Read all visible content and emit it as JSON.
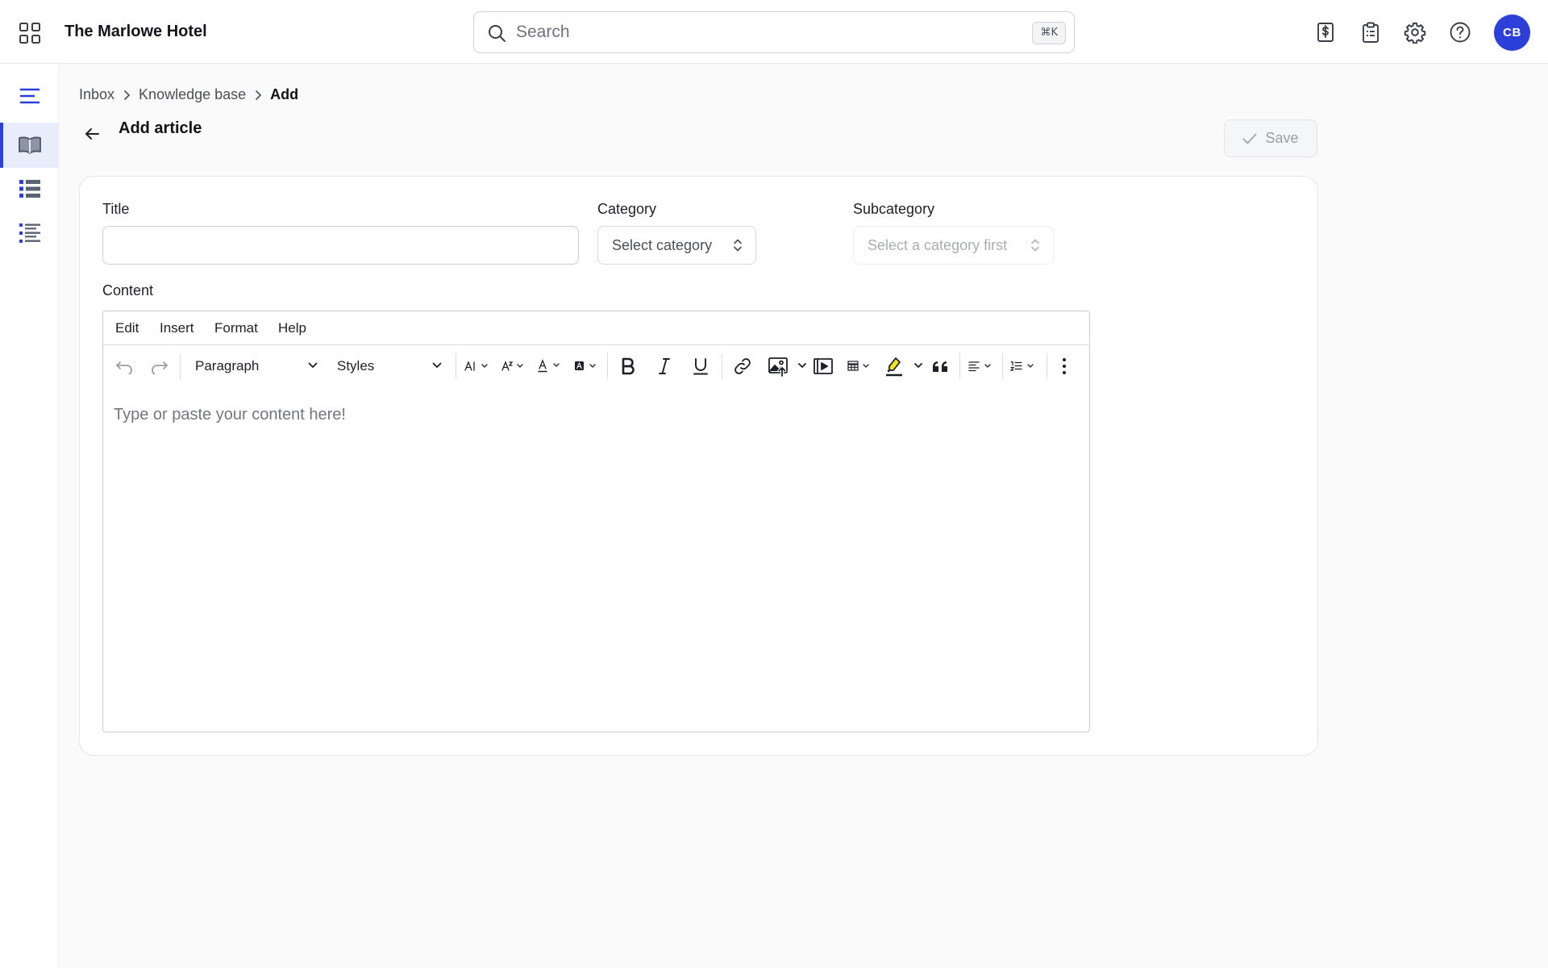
{
  "app": {
    "hotel_name": "The Marlowe Hotel",
    "apps_icon": "grid-icon",
    "search": {
      "placeholder": "Search",
      "shortcut": "⌘K"
    },
    "header_icons": [
      "billing-icon",
      "clipboard-icon",
      "gear-icon",
      "help-icon"
    ],
    "user": {
      "initials": "CB"
    }
  },
  "rail": {
    "items": [
      {
        "icon": "menu-lines-icon",
        "active": false
      },
      {
        "icon": "book-icon",
        "active": true
      },
      {
        "icon": "list-icon",
        "active": false
      },
      {
        "icon": "list-details-icon",
        "active": false
      }
    ]
  },
  "breadcrumb": {
    "items": [
      "Inbox",
      "Knowledge base"
    ],
    "current": "Add"
  },
  "page": {
    "title": "Add article",
    "save_label": "Save"
  },
  "form": {
    "title_label": "Title",
    "title_value": "",
    "category_label": "Category",
    "category_placeholder": "Select category",
    "subcategory_label": "Subcategory",
    "subcategory_placeholder": "Select a category first",
    "content_label": "Content"
  },
  "editor": {
    "menus": [
      "Edit",
      "Insert",
      "Format",
      "Help"
    ],
    "block_format": "Paragraph",
    "styles": "Styles",
    "placeholder": "Type or paste your content here!"
  },
  "colors": {
    "accent": "#2c3fd9",
    "highlight": "#f4e51c",
    "background": "#fafafb"
  }
}
